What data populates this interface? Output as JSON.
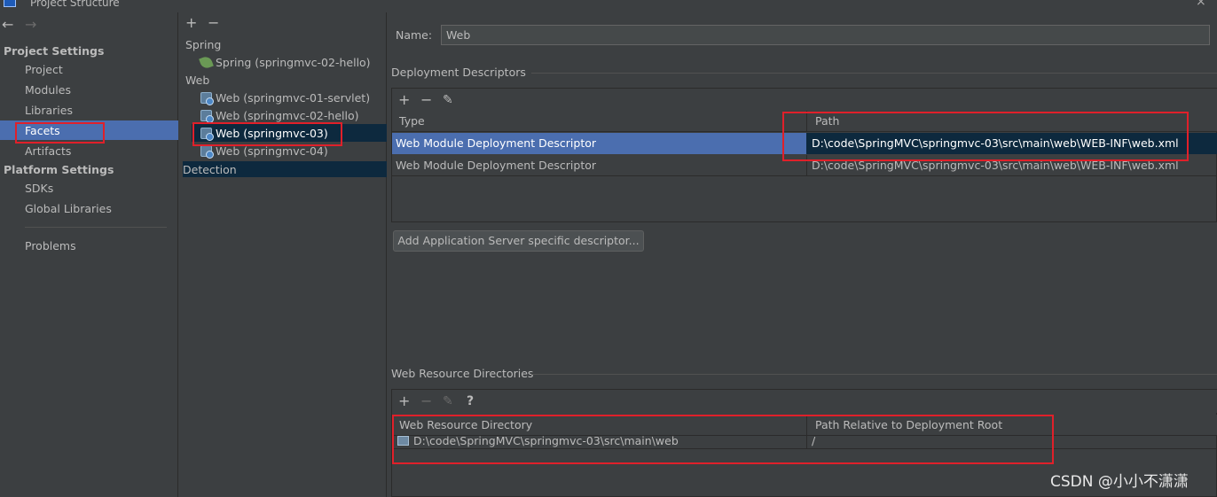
{
  "window": {
    "title": "Project Structure",
    "close": "×"
  },
  "nav": {
    "back": "←",
    "forward": "→"
  },
  "left": {
    "project_settings_header": "Project Settings",
    "project_settings_items": [
      "Project",
      "Modules",
      "Libraries",
      "Facets",
      "Artifacts"
    ],
    "platform_settings_header": "Platform Settings",
    "platform_settings_items": [
      "SDKs",
      "Global Libraries"
    ],
    "problems": "Problems",
    "selected": "Facets"
  },
  "middle": {
    "add": "+",
    "remove": "−",
    "categories": [
      {
        "label": "Spring",
        "items": [
          "Spring (springmvc-02-hello)"
        ]
      },
      {
        "label": "Web",
        "items": [
          "Web (springmvc-01-servlet)",
          "Web (springmvc-02-hello)",
          "Web (springmvc-03)",
          "Web (springmvc-04)"
        ]
      }
    ],
    "selected": "Web (springmvc-03)",
    "detection": "Detection"
  },
  "right": {
    "name_label": "Name:",
    "name_value": "Web",
    "deployment": {
      "title": "Deployment Descriptors",
      "toolbar": {
        "add": "+",
        "remove": "−",
        "edit": "✎"
      },
      "columns": [
        "Type",
        "Path"
      ],
      "rows": [
        {
          "type": "Web Module Deployment Descriptor",
          "path": "D:\\code\\SpringMVC\\springmvc-03\\src\\main\\web\\WEB-INF\\web.xml"
        },
        {
          "type": "Web Module Deployment Descriptor",
          "path": "D:\\code\\SpringMVC\\springmvc-03\\src\\main\\web\\WEB-INF\\web.xml"
        }
      ],
      "add_server_button": "Add Application Server specific descriptor..."
    },
    "resources": {
      "title": "Web Resource Directories",
      "toolbar": {
        "add": "+",
        "remove": "−",
        "edit": "✎",
        "help": "?"
      },
      "columns": [
        "Web Resource Directory",
        "Path Relative to Deployment Root"
      ],
      "rows": [
        {
          "directory": "D:\\code\\SpringMVC\\springmvc-03\\src\\main\\web",
          "relative": "/"
        }
      ]
    }
  },
  "watermark": "CSDN @小小不潇潇",
  "colors": {
    "background": "#3c3f41",
    "selection": "#4b6eaf",
    "inactive_selection": "#0d293e",
    "annotation_red": "#e0202a"
  }
}
